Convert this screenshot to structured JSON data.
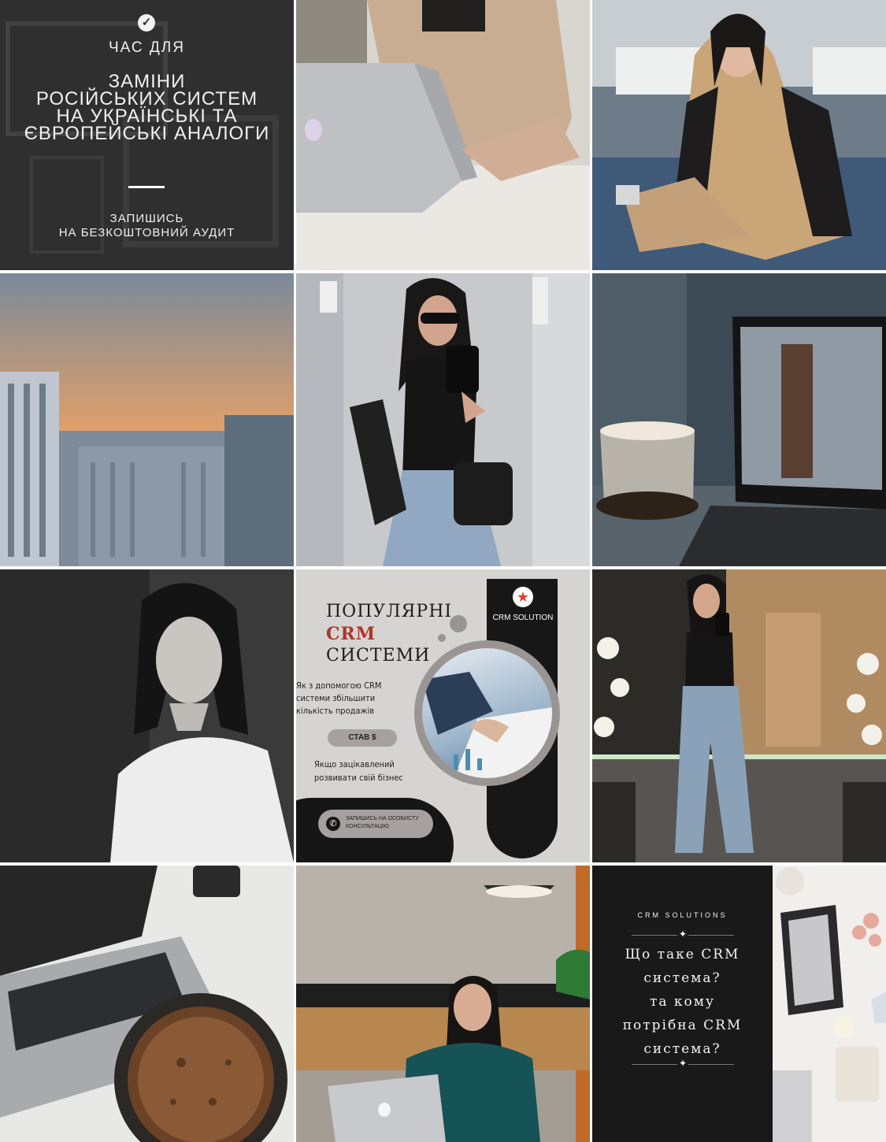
{
  "tiles": {
    "t1": {
      "small": "ЧАС ДЛЯ",
      "big": "ЗАМІНИ\nРОСІЙСЬКИХ СИСТЕМ\nНА УКРАЇНСЬКІ ТА\nЄВРОПЕЙСЬКІ АНАЛОГИ",
      "cta": "ЗАПИШИСЬ\nНА БЕЗКОШТОВНИЙ АУДИТ"
    },
    "t8": {
      "heading_1": "ПОПУЛЯРНІ",
      "heading_2": "CRM",
      "heading_3": "СИСТЕМИ",
      "brand": "CRM SOLUTION",
      "sub": "Як з допомогою CRM системи збільшити кількість продажів",
      "pill": "СТАВ $",
      "note": "Якщо зацікавлений розвивати свій бізнес",
      "call": "ЗАПИШИСЬ НА ОСОБИСТУ КОНСУЛЬТАЦІЮ"
    },
    "t12": {
      "brand": "CRM SOLUTIONS",
      "question": "Що таке CRM\nсистема?\nта кому\nпотрібна CRM\nсистема?"
    }
  },
  "icons": {
    "check": "check-circle-icon",
    "phone": "phone-icon",
    "star": "star-icon",
    "apple": "apple-logo-icon"
  },
  "colors": {
    "accent_red": "#b03427",
    "dark": "#1a1919",
    "promo_bg": "#2f2f30"
  }
}
